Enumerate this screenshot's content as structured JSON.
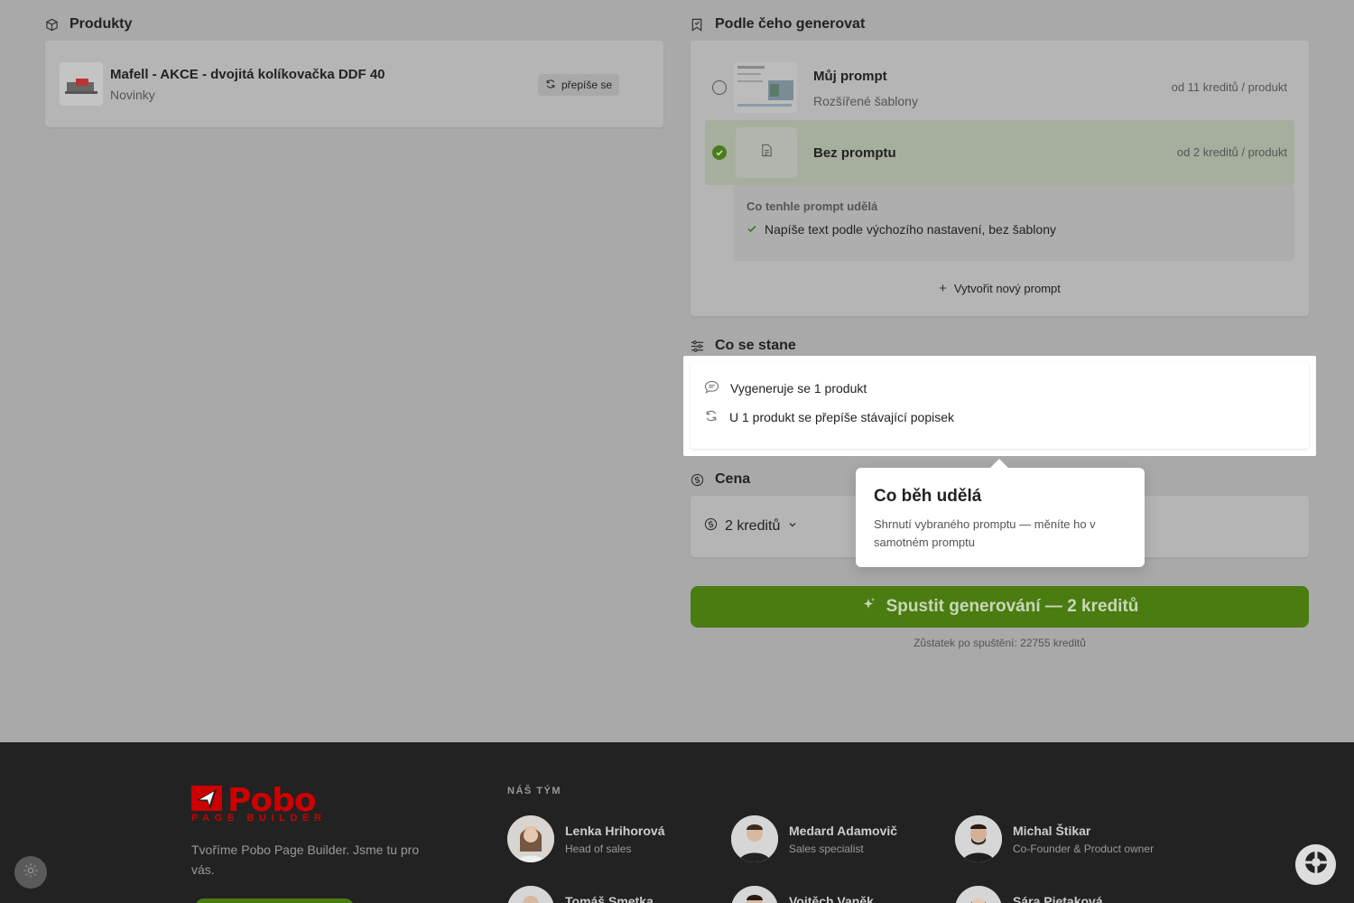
{
  "products": {
    "title": "Produkty",
    "item": {
      "name": "Mafell - AKCE - dvojitá kolíkovačka DDF 40",
      "category": "Novinky",
      "chip_label": "přepíše se"
    }
  },
  "prompt_section": {
    "title": "Podle čeho generovat",
    "options": [
      {
        "title": "Můj prompt",
        "subtitle": "Rozšířené šablony",
        "price": "od 11 kreditů / produkt",
        "selected": false
      },
      {
        "title": "Bez promptu",
        "subtitle": "",
        "price": "od 2 kreditů / produkt",
        "selected": true
      }
    ],
    "detail": {
      "heading": "Co tenhle prompt udělá",
      "items": [
        "Napíše text podle výchozího nastavení, bez šablony"
      ]
    },
    "new_prompt_label": "Vytvořit nový prompt"
  },
  "happen_section": {
    "title": "Co se stane",
    "items": [
      "Vygeneruje se 1 produkt",
      "U 1 produkt se přepíše stávající popisek"
    ]
  },
  "tooltip": {
    "title": "Co běh udělá",
    "body": "Shrnutí vybraného promptu — měníte ho v samotném promptu"
  },
  "price_section": {
    "title": "Cena",
    "value": "2 kreditů"
  },
  "run_button": {
    "label": "Spustit generování — 2 kreditů"
  },
  "balance": "Zůstatek po spuštění: 22755 kreditů",
  "footer": {
    "logo_word": "Pobo",
    "logo_sub": "PAGE BUILDER",
    "tagline": "Tvoříme Pobo Page Builder. Jsme tu pro vás.",
    "team_heading": "NÁŠ TÝM",
    "team": [
      {
        "name": "Lenka Hrihorová",
        "role": "Head of sales"
      },
      {
        "name": "Medard Adamovič",
        "role": "Sales specialist"
      },
      {
        "name": "Michal Štikar",
        "role": "Co-Founder & Product owner"
      },
      {
        "name": "Tomáš Smetka",
        "role": ""
      },
      {
        "name": "Vojtěch Vaněk",
        "role": ""
      },
      {
        "name": "Sára Pietaková",
        "role": ""
      }
    ]
  },
  "colors": {
    "accent_green": "#4a7c12",
    "brand_red": "#cc0000",
    "footer_bg": "#222222"
  }
}
